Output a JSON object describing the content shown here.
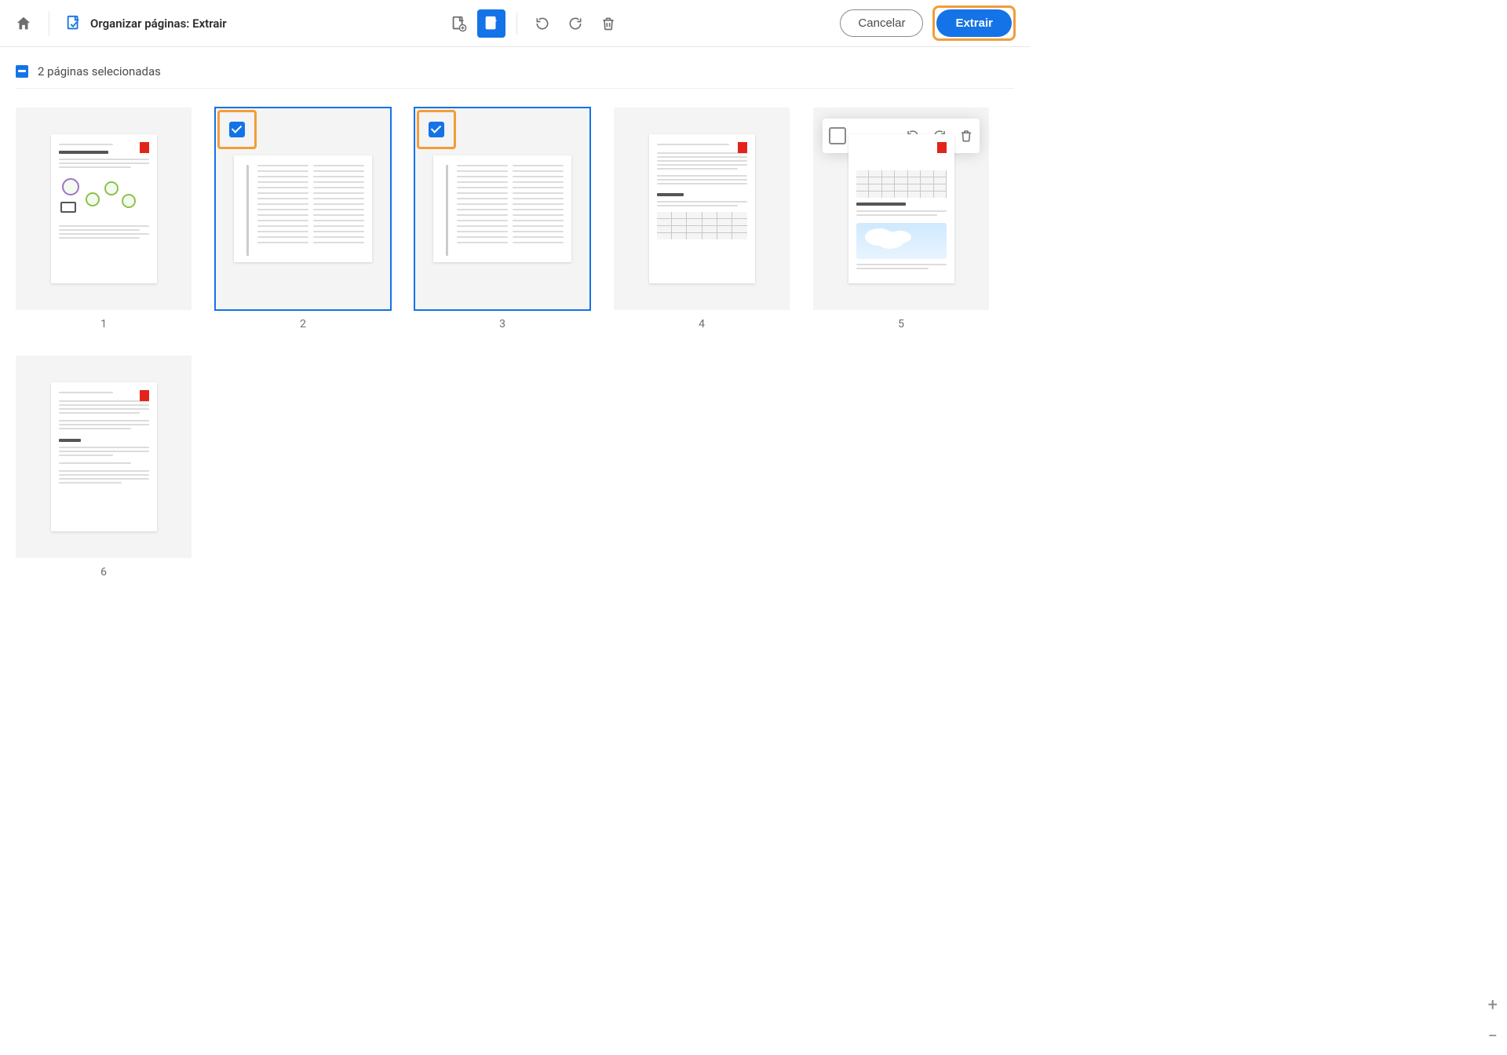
{
  "header": {
    "title": "Organizar páginas: Extrair",
    "cancel_label": "Cancelar",
    "primary_label": "Extrair",
    "highlight_primary": true,
    "tool_icons": [
      "insert-page",
      "extract-page",
      "rotate-ccw",
      "rotate-cw",
      "delete"
    ]
  },
  "selection": {
    "count_text": "2 páginas selecionadas"
  },
  "pages": [
    {
      "number": "1",
      "selected": false,
      "checked": false,
      "hover_tools": false,
      "orientation": "portrait",
      "kind": "cover"
    },
    {
      "number": "2",
      "selected": true,
      "checked": true,
      "hover_tools": false,
      "orientation": "landscape",
      "kind": "text3col",
      "check_highlight": true
    },
    {
      "number": "3",
      "selected": true,
      "checked": true,
      "hover_tools": false,
      "orientation": "landscape",
      "kind": "text3col",
      "check_highlight": true
    },
    {
      "number": "4",
      "selected": false,
      "checked": false,
      "hover_tools": false,
      "orientation": "portrait",
      "kind": "text_table"
    },
    {
      "number": "5",
      "selected": false,
      "checked": false,
      "hover_tools": true,
      "orientation": "portrait",
      "kind": "table_cloud"
    },
    {
      "number": "6",
      "selected": false,
      "checked": false,
      "hover_tools": false,
      "orientation": "portrait",
      "kind": "text_only"
    }
  ],
  "hover_toolbar_icons": [
    "select-toggle",
    "rotate-ccw",
    "rotate-cw",
    "delete"
  ],
  "zoom": {
    "in": "+",
    "out": "−"
  },
  "colors": {
    "accent": "#1473e6",
    "highlight": "#f29d38"
  }
}
